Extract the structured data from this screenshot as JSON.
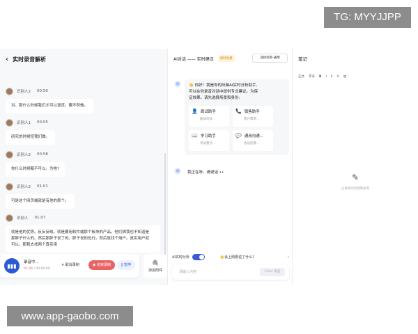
{
  "watermark_top": "TG: MYYJJPP",
  "watermark_bottom": "www.app-gaobo.com",
  "left": {
    "title": "实时录音解析",
    "messages": [
      {
        "speaker": "识别人2",
        "time": "00:50",
        "text": "对。那什么时候我们才可以退货。要不然做。"
      },
      {
        "speaker": "识别人1",
        "time": "00:55",
        "text": "研究的时候挖我们做。"
      },
      {
        "speaker": "识别人2",
        "time": "00:58",
        "text": "你什么时候都不可以。为啥?"
      },
      {
        "speaker": "识别人2",
        "time": "01:01",
        "text": "可是这个网页端就是有他的那个。"
      },
      {
        "speaker": "识别人",
        "time": "01:07",
        "text_lines": [
          "就是他的优势。反反反映。就是要用软件端那个板块的产品。他们俩我也不知道是",
          "那胖子什么的。然后那胖子说了的。胖子说的也行。然后就找个用户。真实用户就",
          "可以。那我去找两个真实用"
        ]
      }
    ],
    "recorder": {
      "status": "录音中...",
      "elapsed": "01:26",
      "total": "/ 00:00:00",
      "cancel": "取消录制",
      "end": "结束录制",
      "pause": "暂停"
    },
    "attach": "添加附件"
  },
  "middle": {
    "title": "AI对话 —— 实时建议",
    "badge": "限时免费",
    "scene_button": "选择场景-通用",
    "greeting_lines": [
      "你好！我是你的听脑AI实时分析助手,",
      "可以在你录音对话中提供专业建议。为保",
      "证效果。请先选择场景和身份:"
    ],
    "cards": [
      {
        "icon": "👤",
        "title": "面试助手",
        "sub": "面试问答..."
      },
      {
        "icon": "📞",
        "title": "销售助手",
        "sub": "客户需求..."
      },
      {
        "icon": "📖",
        "title": "学习助手",
        "sub": "考试重点..."
      },
      {
        "icon": "💬",
        "title": "通用沟通...",
        "sub": "会议纪要..."
      }
    ],
    "listening": "我正在听。请说话 ••",
    "ai_label": "AI实时分析",
    "question": "会上刚刚说了什么?",
    "input_placeholder": "请输入内容",
    "send_label": "Enter 发送"
  },
  "right": {
    "title": "笔记",
    "toolbar": [
      "正文",
      "字号",
      "B",
      "I",
      "S",
      "U",
      "▤"
    ],
    "empty_text": "记录你的灵感和思考"
  },
  "colors": {
    "accent": "#3a5bd6",
    "danger": "#e86464",
    "badge": "#d08a1c"
  }
}
